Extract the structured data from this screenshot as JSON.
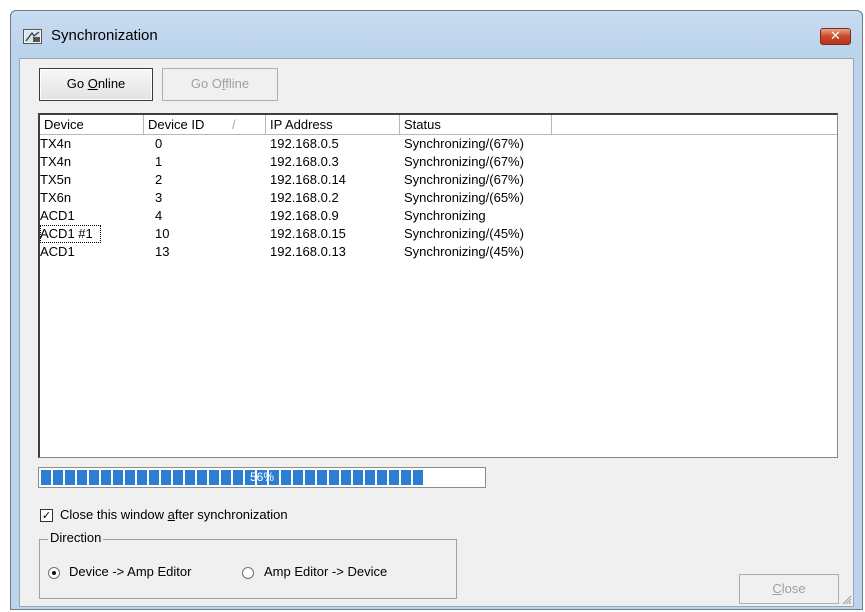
{
  "window": {
    "title": "Synchronization",
    "icon": "sync-app-icon"
  },
  "toolbar": {
    "go_online": {
      "label_pre": "Go ",
      "label_key": "O",
      "label_post": "nline"
    },
    "go_offline": {
      "label_pre": "Go O",
      "label_key": "f",
      "label_post": "fline"
    }
  },
  "list": {
    "columns": [
      "Device",
      "Device ID",
      "IP Address",
      "Status"
    ],
    "sort_indicator": "/",
    "rows": [
      {
        "device": "TX4n",
        "id": "0",
        "ip": "192.168.0.5",
        "status": "Synchronizing/(67%)"
      },
      {
        "device": "TX4n",
        "id": "1",
        "ip": "192.168.0.3",
        "status": "Synchronizing/(67%)"
      },
      {
        "device": "TX5n",
        "id": "2",
        "ip": "192.168.0.14",
        "status": "Synchronizing/(67%)"
      },
      {
        "device": "TX6n",
        "id": "3",
        "ip": "192.168.0.2",
        "status": "Synchronizing/(65%)"
      },
      {
        "device": "ACD1",
        "id": "4",
        "ip": "192.168.0.9",
        "status": "Synchronizing"
      },
      {
        "device": "ACD1 #1",
        "id": "10",
        "ip": "192.168.0.15",
        "status": "Synchronizing/(45%)"
      },
      {
        "device": "ACD1",
        "id": "13",
        "ip": "192.168.0.13",
        "status": "Synchronizing/(45%)"
      }
    ]
  },
  "progress": {
    "label": "56%",
    "value": 0.87,
    "color": "#2a7fd3"
  },
  "options": {
    "close_after_pre": "Close this window ",
    "close_after_key": "a",
    "close_after_post": "fter synchronization",
    "close_after_checked": true
  },
  "direction": {
    "legend": "Direction",
    "option1": "Device -> Amp Editor",
    "option2": "Amp Editor -> Device",
    "selected": 1
  },
  "footer": {
    "close_key": "C",
    "close_post": "lose"
  }
}
